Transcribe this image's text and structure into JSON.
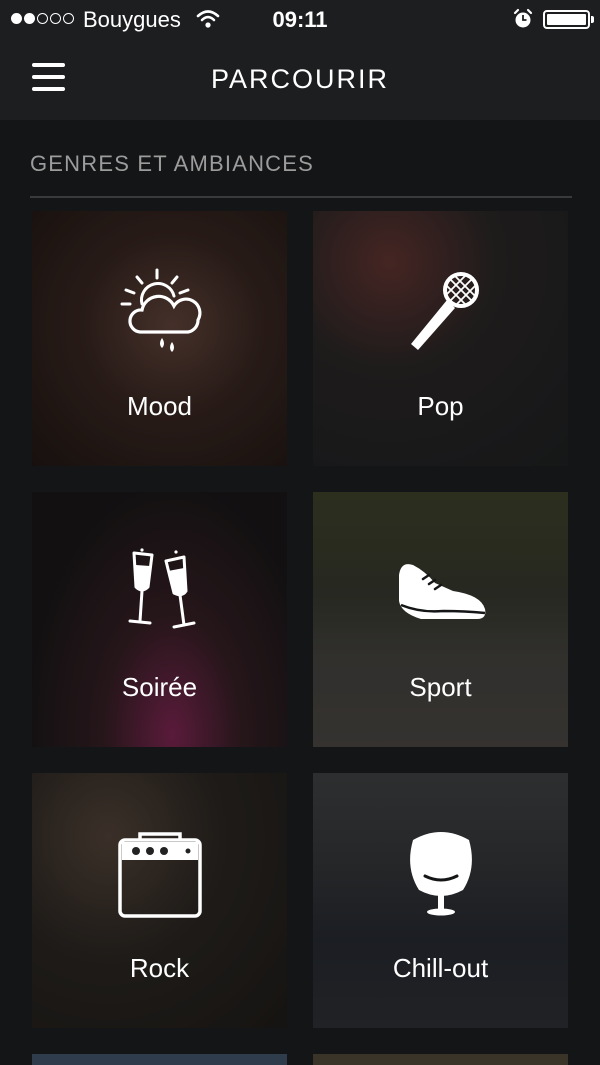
{
  "status_bar": {
    "carrier": "Bouygues",
    "time": "09:11",
    "signal_strength": 2,
    "signal_max": 5,
    "icons": [
      "wifi-icon",
      "alarm-icon",
      "battery-icon"
    ]
  },
  "nav": {
    "title": "PARCOURIR",
    "menu_icon": "menu-icon"
  },
  "section": {
    "title": "GENRES ET AMBIANCES"
  },
  "tiles": [
    {
      "label": "Mood",
      "icon": "weather-sun-cloud-rain-icon"
    },
    {
      "label": "Pop",
      "icon": "microphone-icon"
    },
    {
      "label": "Soirée",
      "icon": "champagne-glasses-icon"
    },
    {
      "label": "Sport",
      "icon": "sneaker-icon"
    },
    {
      "label": "Rock",
      "icon": "amplifier-icon"
    },
    {
      "label": "Chill-out",
      "icon": "egg-chair-icon"
    }
  ],
  "colors": {
    "background": "#141516",
    "bar": "#1d1e20",
    "section_text": "#9c9c9c",
    "text": "#ffffff"
  }
}
